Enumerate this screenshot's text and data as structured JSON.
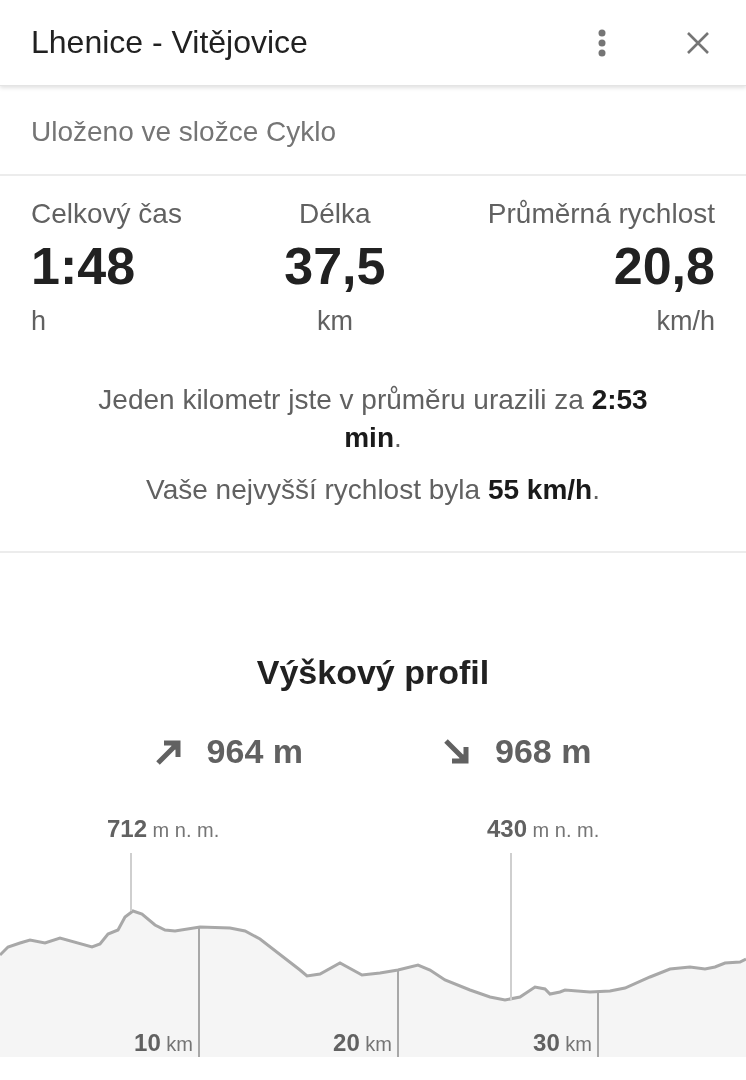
{
  "header": {
    "title": "Lhenice - Vitějovice"
  },
  "folder": "Uloženo ve složce Cyklo",
  "stats": [
    {
      "label": "Celkový čas",
      "value": "1:48",
      "unit": "h"
    },
    {
      "label": "Délka",
      "value": "37,5",
      "unit": "km"
    },
    {
      "label": "Průměrná rychlost",
      "value": "20,8",
      "unit": "km/h"
    }
  ],
  "notes": [
    "Jeden kilometr jste v průměru urazili za **2:53 min**.",
    "Vaše nejvyšší rychlost byla **55 km/h**."
  ],
  "elevation": {
    "title": "Výškový profil",
    "totals": [
      {
        "kind": "ascent",
        "value": "964 m"
      },
      {
        "kind": "descent",
        "value": "968 m"
      }
    ],
    "extremes": [
      {
        "value": "712",
        "unit": "m n. m."
      },
      {
        "value": "430",
        "unit": "m n. m."
      }
    ],
    "distance_marks": [
      {
        "value": "10",
        "unit": "km"
      },
      {
        "value": "20",
        "unit": "km"
      },
      {
        "value": "30",
        "unit": "km"
      }
    ]
  }
}
